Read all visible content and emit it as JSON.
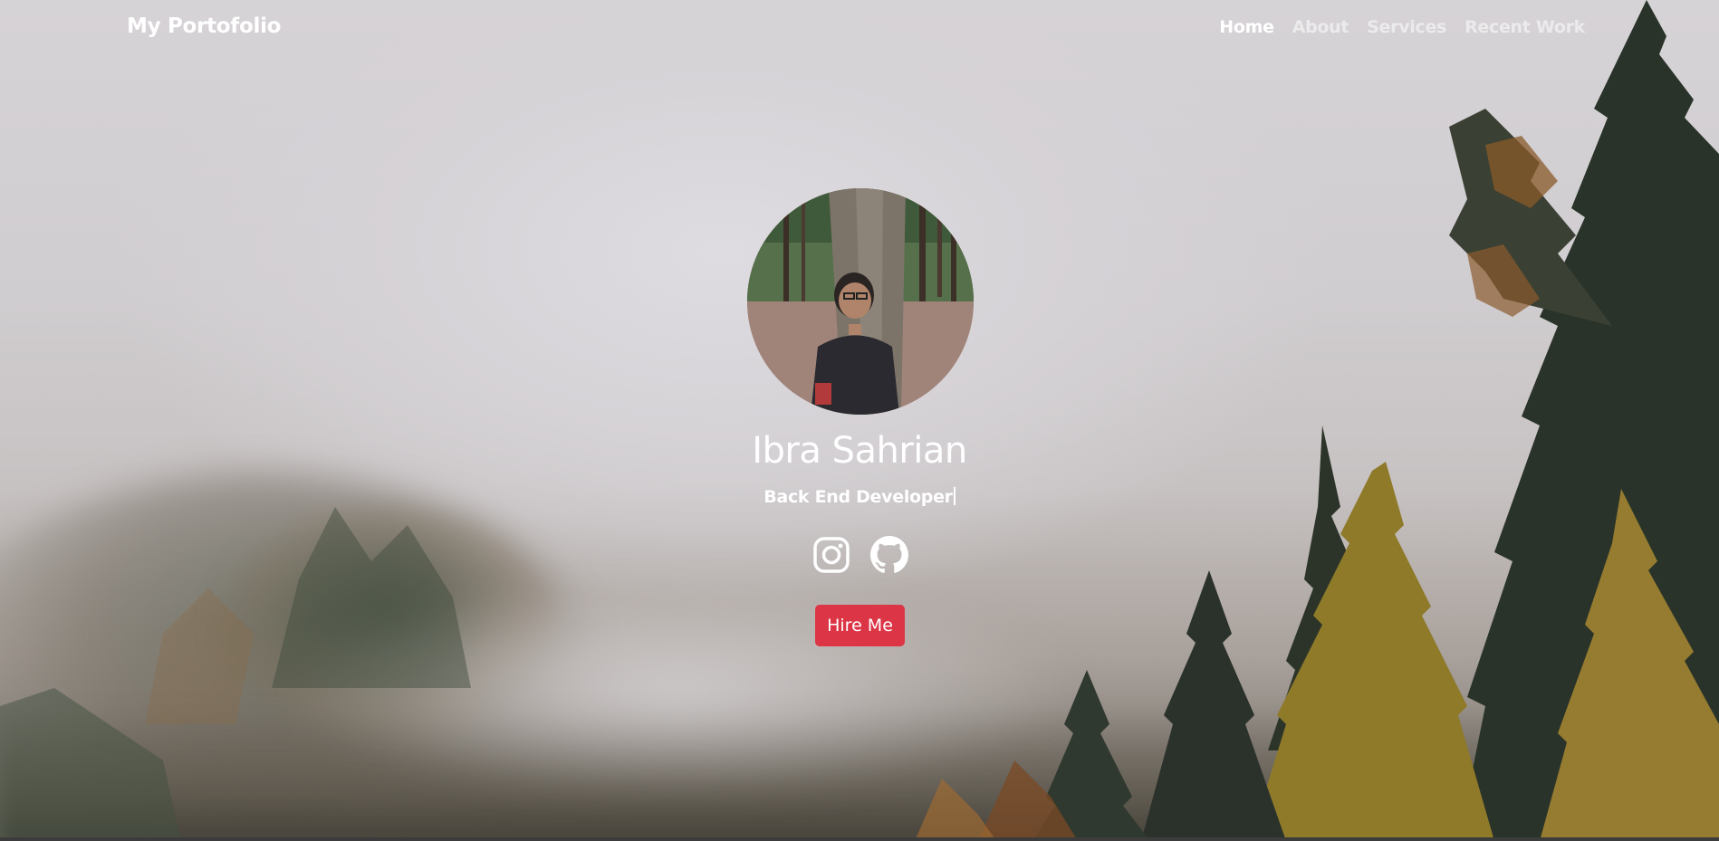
{
  "navbar": {
    "brand": "My Portofolio",
    "items": [
      {
        "label": "Home",
        "active": true
      },
      {
        "label": "About",
        "active": false
      },
      {
        "label": "Services",
        "active": false
      },
      {
        "label": "Recent Work",
        "active": false
      }
    ]
  },
  "hero": {
    "name": "Ibra Sahrian",
    "role": "Back End Developer",
    "socials": [
      {
        "icon": "instagram-icon"
      },
      {
        "icon": "github-icon"
      }
    ],
    "cta_label": "Hire Me"
  },
  "colors": {
    "accent": "#dc3545",
    "nav_active": "#ffffff",
    "nav_inactive": "rgba(255,255,255,0.55)"
  }
}
